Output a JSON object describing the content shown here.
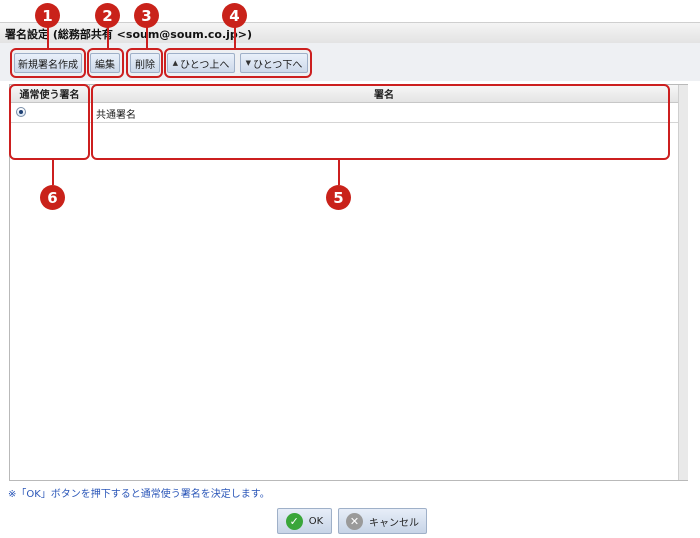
{
  "window": {
    "title": "署名設定 (総務部共有 <soum@soum.co.jp>)"
  },
  "toolbar": {
    "new_label": "新規署名作成",
    "edit_label": "編集",
    "delete_label": "削除",
    "up_label": "ひとつ上へ",
    "down_label": "ひとつ下へ"
  },
  "table": {
    "columns": [
      "通常使う署名",
      "署名"
    ],
    "rows": [
      {
        "selected": true,
        "signature": "共通署名"
      }
    ]
  },
  "note": "※「OK」ボタンを押下すると通常使う署名を決定します。",
  "footer": {
    "ok_label": "OK",
    "cancel_label": "キャンセル"
  },
  "callouts": [
    "1",
    "2",
    "3",
    "4",
    "5",
    "6"
  ],
  "colors": {
    "annotation_red": "#c9221a",
    "note_blue": "#2a56b8",
    "button_blue": "#cdd9ea"
  }
}
